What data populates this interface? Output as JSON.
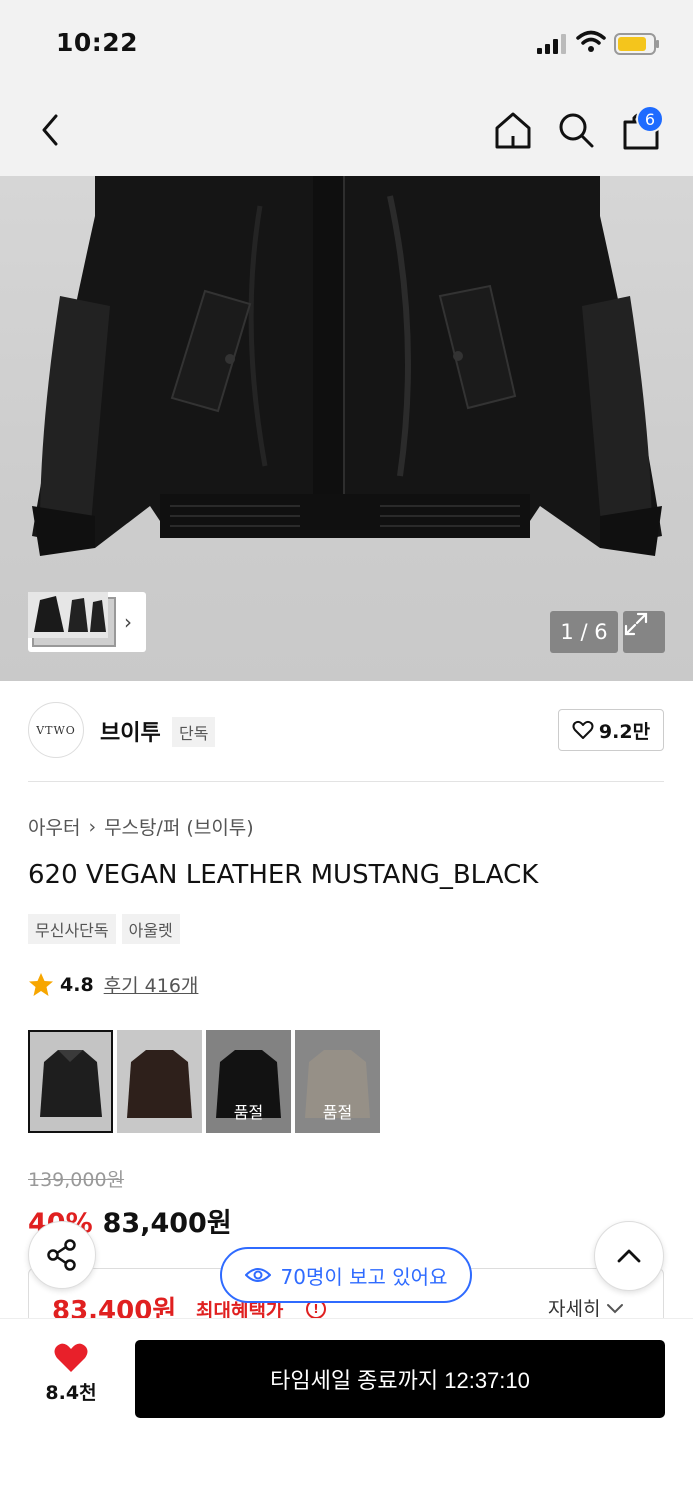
{
  "status_bar": {
    "time": "10:22"
  },
  "nav": {
    "cart_count": "6"
  },
  "gallery": {
    "counter": "1 / 6"
  },
  "brand": {
    "logo_text": "VTWO",
    "name": "브이투",
    "tag": "단독",
    "likes": "9.2만"
  },
  "breadcrumb": {
    "category": "아우터",
    "subcategory": "무스탕/퍼 (브이투)"
  },
  "product": {
    "title": "620 VEGAN LEATHER MUSTANG_BLACK",
    "tags": [
      "무신사단독",
      "아울렛"
    ],
    "rating": "4.8",
    "reviews": "후기 416개"
  },
  "variants": [
    {
      "color": "#2a2a2a",
      "sold_out": ""
    },
    {
      "color": "#3b2a24",
      "sold_out": ""
    },
    {
      "color": "#262626",
      "sold_out": "품절"
    },
    {
      "color": "#d9d1c4",
      "sold_out": "품절"
    }
  ],
  "pricing": {
    "original": "139,000원",
    "discount": "40%",
    "price": "83,400원",
    "benefit_price": "83,400원",
    "benefit_label": "최대혜택가",
    "detail_link": "자세히"
  },
  "viewers": "70명이 보고 있어요",
  "bottom_bar": {
    "wish_count": "8.4천",
    "buy_label": "타임세일 종료까지 12:37:10"
  },
  "colors": {
    "accent_red": "#e02020",
    "accent_blue": "#2f6bff",
    "badge_blue": "#1e6bff"
  }
}
